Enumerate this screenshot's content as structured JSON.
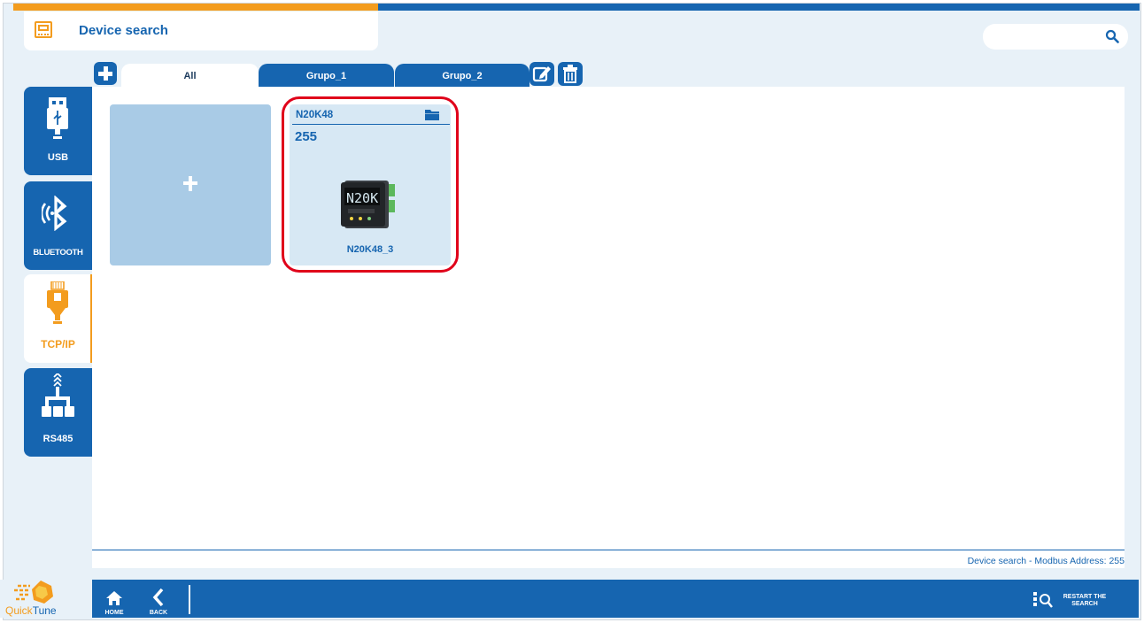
{
  "header": {
    "title": "Device search",
    "icon": "controller-icon"
  },
  "search": {
    "value": "",
    "icon": "search-icon"
  },
  "tabs": [
    {
      "label": "All",
      "active": true
    },
    {
      "label": "Grupo_1",
      "active": false
    },
    {
      "label": "Grupo_2",
      "active": false
    }
  ],
  "sidebar": {
    "items": [
      {
        "label": "USB",
        "icon": "usb-icon",
        "active": false
      },
      {
        "label": "BLUETOOTH",
        "icon": "bluetooth-icon",
        "active": false
      },
      {
        "label": "TCP/IP",
        "icon": "ethernet-icon",
        "active": true
      },
      {
        "label": "RS485",
        "icon": "network-icon",
        "active": false
      }
    ]
  },
  "devices": [
    {
      "model": "N20K48",
      "address": "255",
      "name": "N20K48_3",
      "icon": "folder-icon",
      "highlighted": true
    }
  ],
  "status": {
    "text": "Device search - Modbus Address: 255"
  },
  "bottom_bar": {
    "app_name_part1": "Quick",
    "app_name_part2": "Tune",
    "home_label": "HOME",
    "back_label": "BACK",
    "restart_label_line1": "RESTART THE",
    "restart_label_line2": "SEARCH"
  },
  "colors": {
    "primary": "#1665b0",
    "accent": "#f39c1e",
    "highlight": "#e0001a",
    "background": "#e8f1f8"
  }
}
